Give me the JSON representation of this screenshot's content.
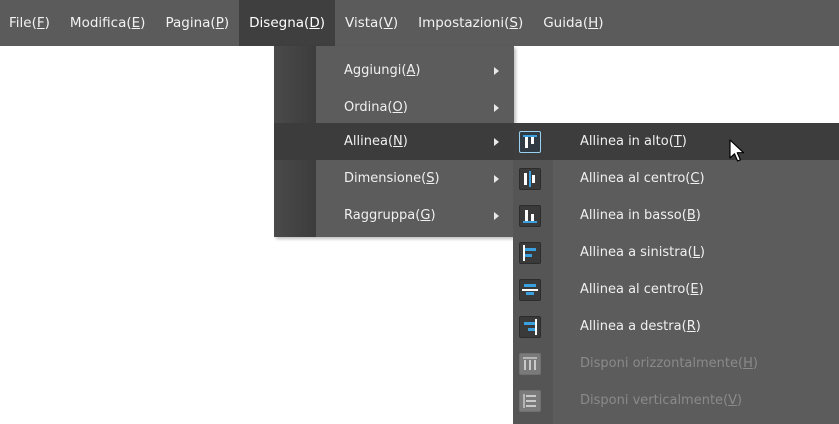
{
  "menubar": {
    "items": [
      {
        "text": "File",
        "key": "F"
      },
      {
        "text": "Modifica",
        "key": "E"
      },
      {
        "text": "Pagina",
        "key": "P"
      },
      {
        "text": "Disegna",
        "key": "D"
      },
      {
        "text": "Vista",
        "key": "V"
      },
      {
        "text": "Impostazioni",
        "key": "S"
      },
      {
        "text": "Guida",
        "key": "H"
      }
    ],
    "active": "Disegna"
  },
  "disegna_menu": {
    "items": [
      {
        "text": "Aggiungi",
        "key": "A"
      },
      {
        "text": "Ordina",
        "key": "O"
      },
      {
        "text": "Allinea",
        "key": "N"
      },
      {
        "text": "Dimensione",
        "key": "S"
      },
      {
        "text": "Raggruppa",
        "key": "G"
      }
    ],
    "highlighted": "Allinea"
  },
  "allinea_menu": {
    "items": [
      {
        "text": "Allinea in alto",
        "key": "T",
        "icon": "align-top-icon",
        "enabled": true
      },
      {
        "text": "Allinea al centro",
        "key": "C",
        "icon": "align-middle-icon",
        "enabled": true
      },
      {
        "text": "Allinea in basso",
        "key": "B",
        "icon": "align-bottom-icon",
        "enabled": true
      },
      {
        "text": "Allinea a sinistra",
        "key": "L",
        "icon": "align-left-icon",
        "enabled": true
      },
      {
        "text": "Allinea al centro",
        "key": "E",
        "icon": "align-center-icon",
        "enabled": true
      },
      {
        "text": "Allinea a destra",
        "key": "R",
        "icon": "align-right-icon",
        "enabled": true
      },
      {
        "text": "Disponi orizzontalmente",
        "key": "H",
        "icon": "distribute-horizontal-icon",
        "enabled": false
      },
      {
        "text": "Disponi verticalmente",
        "key": "V",
        "icon": "distribute-vertical-icon",
        "enabled": false
      }
    ],
    "highlighted": "Allinea in alto"
  },
  "colors": {
    "menubar_bg": "#5b5b5b",
    "menu_bg": "#5c5c5c",
    "highlight_bg": "#3c3c3c",
    "icon_blue": "#3aa0e0",
    "disabled_text": "#8a8a8a"
  },
  "cursor_icon": "mouse-pointer-icon"
}
